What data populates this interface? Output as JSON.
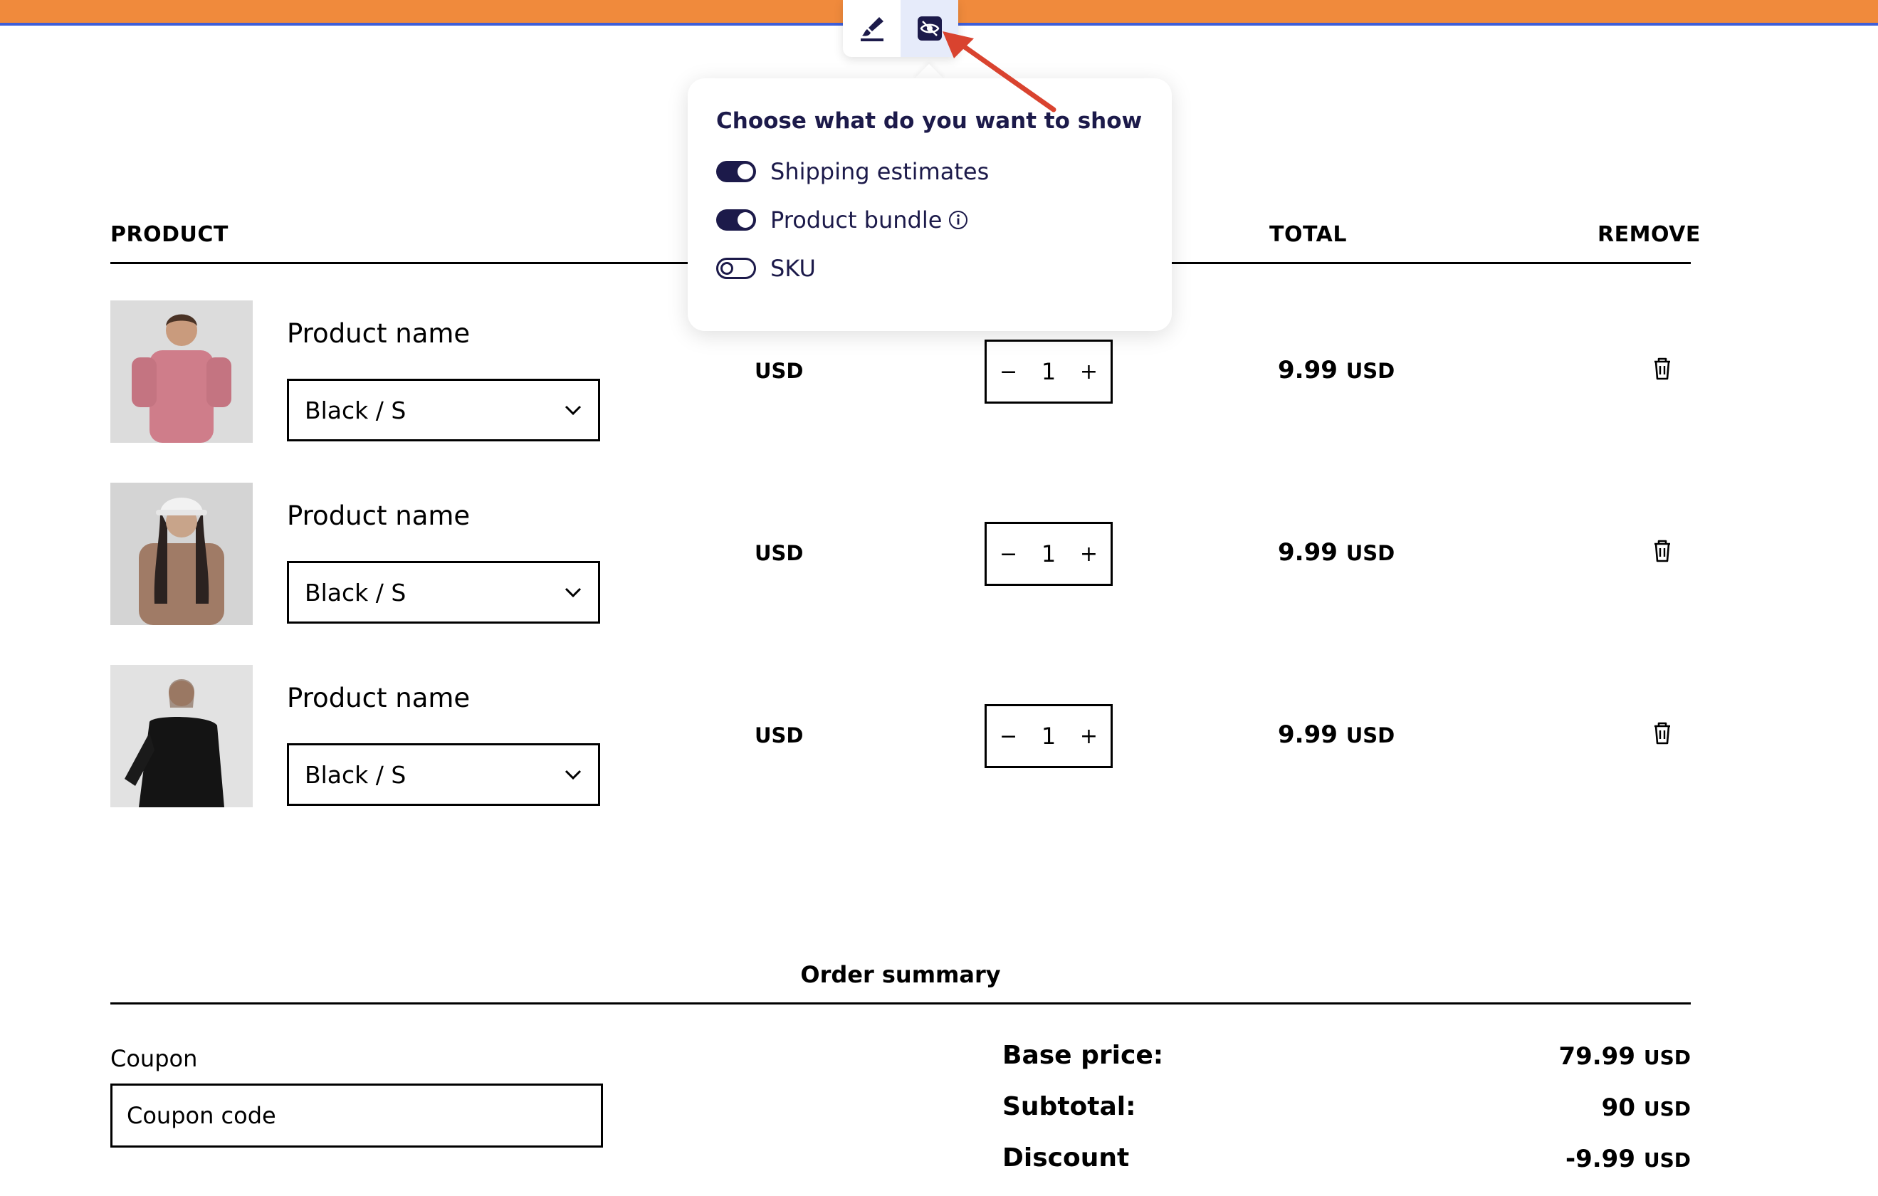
{
  "toolbar": {
    "items": [
      {
        "icon": "brush-icon"
      },
      {
        "icon": "eye-settings-icon"
      }
    ]
  },
  "popover": {
    "title": "Choose what do you want to show",
    "options": [
      {
        "label": "Shipping estimates",
        "enabled": true
      },
      {
        "label": "Product bundle",
        "enabled": true
      },
      {
        "label": "SKU",
        "enabled": false
      }
    ]
  },
  "table": {
    "headers": {
      "product": "PRODUCT",
      "total": "TOTAL",
      "remove": "REMOVE"
    },
    "rows": [
      {
        "name": "Product name",
        "variant": "Black / S",
        "price_currency": "USD",
        "qty": "1",
        "total": "9.99",
        "total_currency": "USD"
      },
      {
        "name": "Product name",
        "variant": "Black / S",
        "price_currency": "USD",
        "qty": "1",
        "total": "9.99",
        "total_currency": "USD"
      },
      {
        "name": "Product name",
        "variant": "Black / S",
        "price_currency": "USD",
        "qty": "1",
        "total": "9.99",
        "total_currency": "USD"
      }
    ],
    "minus": "−",
    "plus": "+"
  },
  "summary": {
    "title": "Order summary",
    "coupon_label": "Coupon",
    "coupon_placeholder": "Coupon code",
    "lines": [
      {
        "label": "Base price:",
        "value": "79.99",
        "currency": "USD"
      },
      {
        "label": "Subtotal:",
        "value": "90",
        "currency": "USD"
      },
      {
        "label": "Discount",
        "value": "-9.99",
        "currency": "USD"
      }
    ]
  },
  "colors": {
    "topbar": "#f08a3c",
    "topbar_border": "#3f5fd8",
    "accent": "#1c1a4a",
    "arrow": "#d9432f"
  }
}
